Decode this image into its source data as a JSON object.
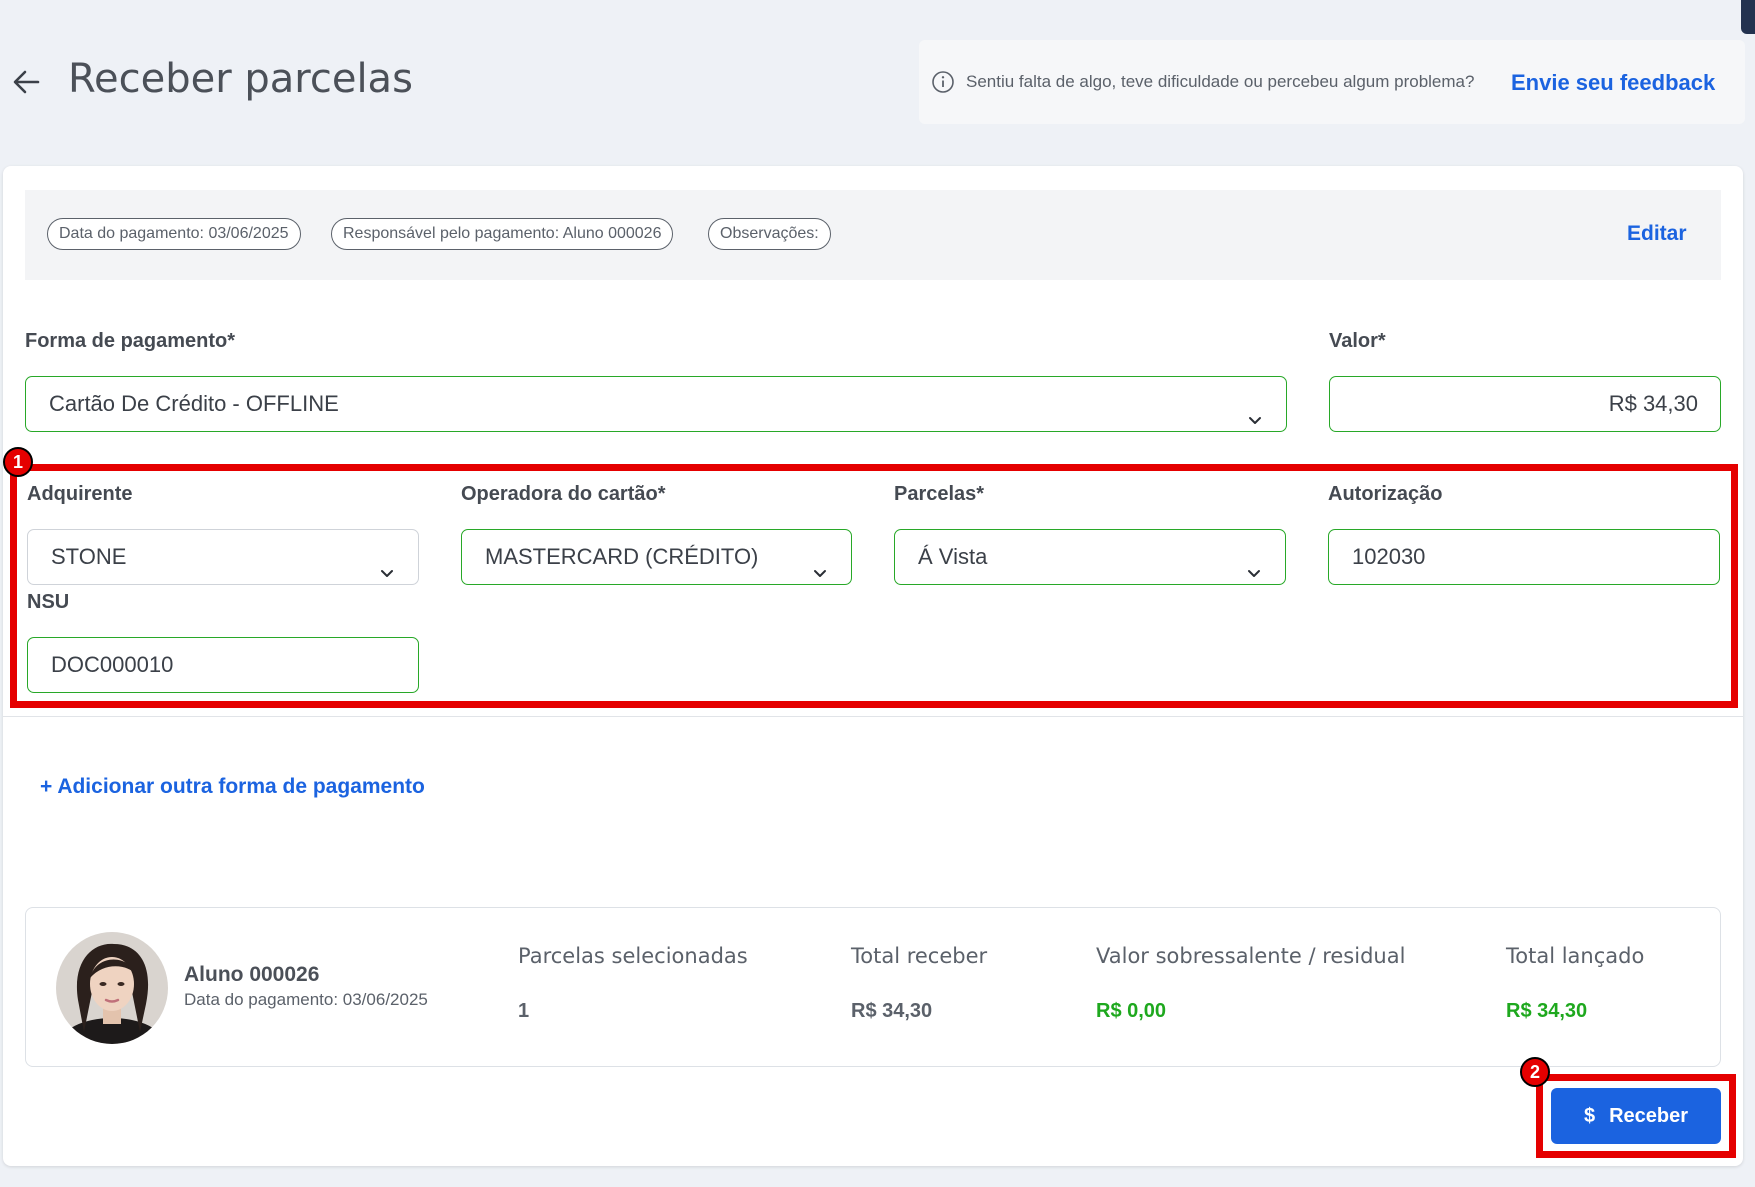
{
  "header": {
    "title": "Receber parcelas",
    "feedback_text": "Sentiu falta de algo, teve dificuldade ou percebeu algum problema?",
    "feedback_link": "Envie seu feedback"
  },
  "info_bar": {
    "chips": [
      "Data do pagamento: 03/06/2025",
      "Responsável pelo pagamento: Aluno 000026",
      "Observações:"
    ],
    "edit_label": "Editar"
  },
  "form": {
    "payment_method": {
      "label": "Forma de pagamento*",
      "value": "Cartão De Crédito - OFFLINE"
    },
    "amount": {
      "label": "Valor*",
      "value": "R$ 34,30"
    },
    "acquirer": {
      "label": "Adquirente",
      "value": "STONE"
    },
    "card_operator": {
      "label": "Operadora do cartão*",
      "value": "MASTERCARD (CRÉDITO)"
    },
    "installments": {
      "label": "Parcelas*",
      "value": "Á Vista"
    },
    "authorization": {
      "label": "Autorização",
      "value": "102030"
    },
    "nsu": {
      "label": "NSU",
      "value": "DOC000010"
    }
  },
  "add_payment_label": "+ Adicionar outra forma de pagamento",
  "summary": {
    "student_name": "Aluno 000026",
    "payment_date": "Data do pagamento: 03/06/2025",
    "columns": [
      {
        "header": "Parcelas selecionadas",
        "value": "1"
      },
      {
        "header": "Total receber",
        "value": "R$ 34,30"
      },
      {
        "header": "Valor sobressalente / residual",
        "value": "R$ 0,00"
      },
      {
        "header": "Total lançado",
        "value": "R$ 34,30"
      }
    ]
  },
  "receive_button": {
    "icon": "$",
    "label": "Receber"
  },
  "annotations": [
    "1",
    "2"
  ],
  "colors": {
    "accent": "#1b63e0",
    "valid": "#28a828",
    "highlight": "#e50000"
  }
}
